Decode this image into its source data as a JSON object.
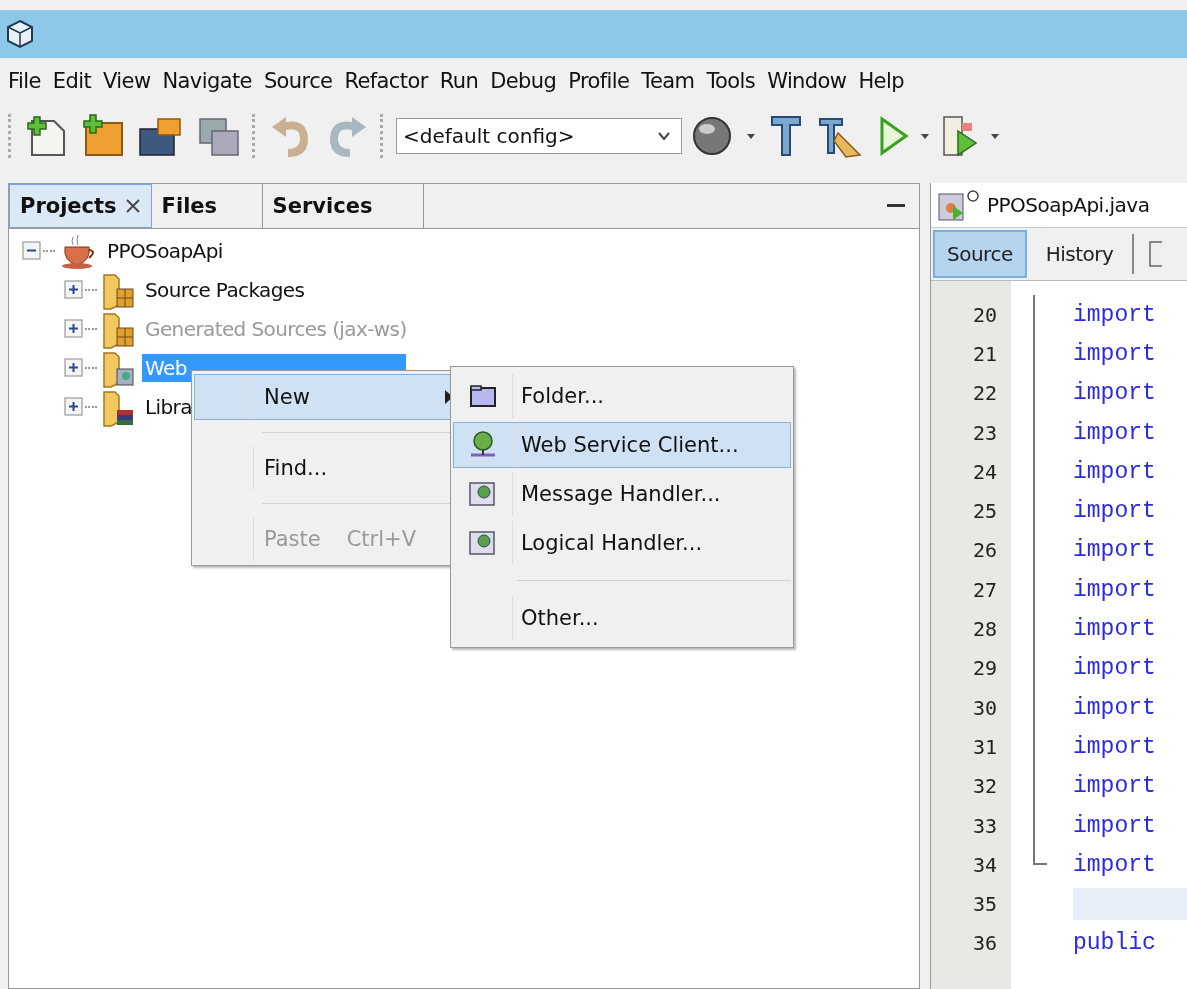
{
  "menu_bar": [
    "File",
    "Edit",
    "View",
    "Navigate",
    "Source",
    "Refactor",
    "Run",
    "Debug",
    "Profile",
    "Team",
    "Tools",
    "Window",
    "Help"
  ],
  "toolbar": {
    "config": "<default config>"
  },
  "projects_panel": {
    "tabs": [
      {
        "label": "Projects",
        "selected": true,
        "closable": true
      },
      {
        "label": "Files",
        "selected": false,
        "closable": false
      },
      {
        "label": "Services",
        "selected": false,
        "closable": false
      }
    ],
    "tree": [
      {
        "label": "PPOSoapApi",
        "kind": "project",
        "expanded": true,
        "selected": false,
        "dimmed": false,
        "children": [
          {
            "label": "Source Packages",
            "kind": "packages",
            "expanded": false,
            "selected": false,
            "dimmed": false
          },
          {
            "label": "Generated Sources (jax-ws)",
            "kind": "packages",
            "expanded": false,
            "selected": false,
            "dimmed": true
          },
          {
            "label": "Web",
            "kind": "webrefs",
            "expanded": false,
            "selected": true,
            "dimmed": false
          },
          {
            "label": "Libra",
            "kind": "libraries",
            "expanded": false,
            "selected": false,
            "dimmed": false
          }
        ]
      }
    ]
  },
  "context_menu": {
    "items": [
      {
        "kind": "item",
        "label": "New",
        "submenu": true,
        "selected": true,
        "disabled": false
      },
      {
        "kind": "separator"
      },
      {
        "kind": "item",
        "label": "Find...",
        "submenu": false,
        "selected": false,
        "disabled": false
      },
      {
        "kind": "separator"
      },
      {
        "kind": "item",
        "label": "Paste",
        "shortcut": "Ctrl+V",
        "submenu": false,
        "selected": false,
        "disabled": true
      }
    ]
  },
  "submenu": {
    "items": [
      {
        "kind": "folder",
        "label": "Folder...",
        "selected": false
      },
      {
        "kind": "client",
        "label": "Web Service Client...",
        "selected": true
      },
      {
        "kind": "handler",
        "label": "Message Handler...",
        "selected": false
      },
      {
        "kind": "handler",
        "label": "Logical Handler...",
        "selected": false
      },
      {
        "kind": "separator"
      },
      {
        "kind": "plain",
        "label": "Other...",
        "selected": false
      }
    ]
  },
  "editor": {
    "file_tab": "PPOSoapApi.java",
    "view_tabs": [
      {
        "label": "Source",
        "selected": true
      },
      {
        "label": "History",
        "selected": false
      }
    ],
    "lines": [
      {
        "number": "20",
        "code": "import",
        "current": false,
        "in_fold": true,
        "fold_end": false
      },
      {
        "number": "21",
        "code": "import",
        "current": false,
        "in_fold": true,
        "fold_end": false
      },
      {
        "number": "22",
        "code": "import",
        "current": false,
        "in_fold": true,
        "fold_end": false
      },
      {
        "number": "23",
        "code": "import",
        "current": false,
        "in_fold": true,
        "fold_end": false
      },
      {
        "number": "24",
        "code": "import",
        "current": false,
        "in_fold": true,
        "fold_end": false
      },
      {
        "number": "25",
        "code": "import",
        "current": false,
        "in_fold": true,
        "fold_end": false
      },
      {
        "number": "26",
        "code": "import",
        "current": false,
        "in_fold": true,
        "fold_end": false
      },
      {
        "number": "27",
        "code": "import",
        "current": false,
        "in_fold": true,
        "fold_end": false
      },
      {
        "number": "28",
        "code": "import",
        "current": false,
        "in_fold": true,
        "fold_end": false
      },
      {
        "number": "29",
        "code": "import",
        "current": false,
        "in_fold": true,
        "fold_end": false
      },
      {
        "number": "30",
        "code": "import",
        "current": false,
        "in_fold": true,
        "fold_end": false
      },
      {
        "number": "31",
        "code": "import",
        "current": false,
        "in_fold": true,
        "fold_end": false
      },
      {
        "number": "32",
        "code": "import",
        "current": false,
        "in_fold": true,
        "fold_end": false
      },
      {
        "number": "33",
        "code": "import",
        "current": false,
        "in_fold": true,
        "fold_end": false
      },
      {
        "number": "34",
        "code": "import",
        "current": false,
        "in_fold": true,
        "fold_end": true
      },
      {
        "number": "35",
        "current": true,
        "in_fold": false,
        "fold_end": false
      },
      {
        "number": "36",
        "code": "public",
        "current": false,
        "in_fold": false,
        "fold_end": false
      }
    ]
  }
}
